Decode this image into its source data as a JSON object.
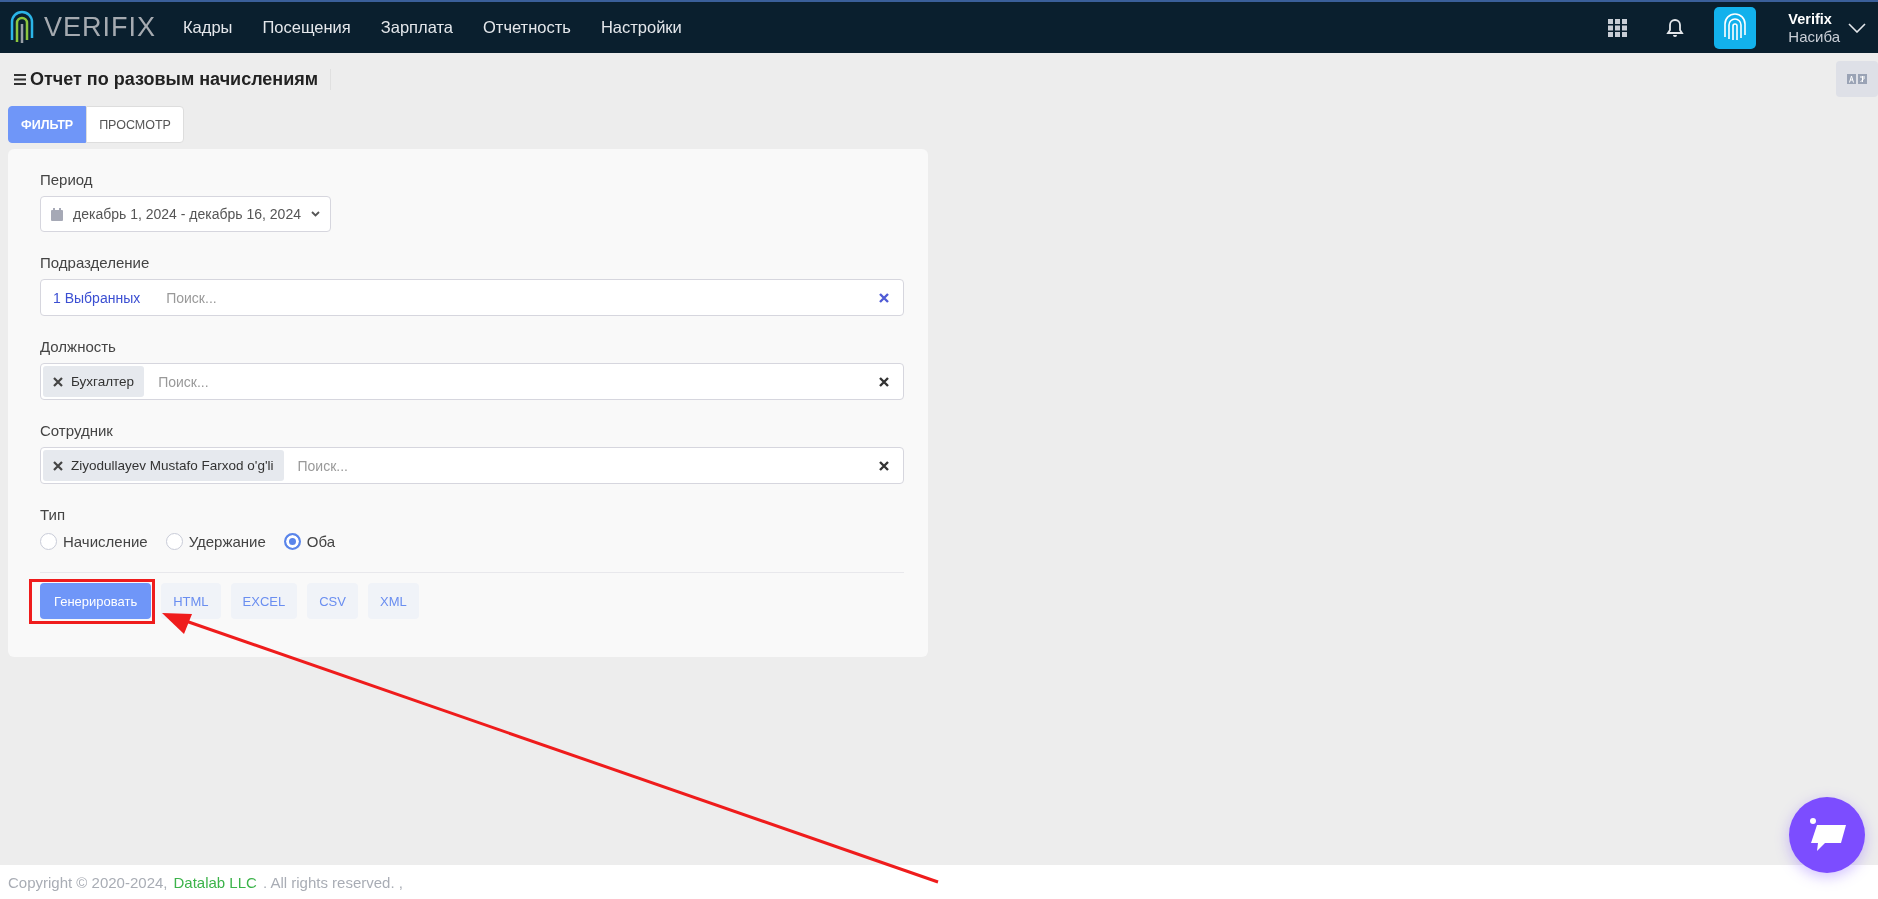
{
  "header": {
    "logo_text": "VERIFIX",
    "nav": [
      "Кадры",
      "Посещения",
      "Зарплата",
      "Отчетность",
      "Настройки"
    ],
    "user": {
      "name": "Verifix",
      "subtitle": "Насиба"
    }
  },
  "page": {
    "title": "Отчет по разовым начислениям"
  },
  "tabs": [
    {
      "label": "ФИЛЬТР",
      "selected": true
    },
    {
      "label": "ПРОСМОТР",
      "selected": false
    }
  ],
  "form": {
    "period": {
      "label": "Период",
      "value": "декабрь 1, 2024 - декабрь 16, 2024"
    },
    "fields": [
      {
        "label": "Подразделение",
        "kind": "summary",
        "summary": "1 Выбранных",
        "placeholder": "Поиск..."
      },
      {
        "label": "Должность",
        "kind": "chips",
        "chips": [
          "Бухгалтер"
        ],
        "placeholder": "Поиск..."
      },
      {
        "label": "Сотрудник",
        "kind": "chips",
        "chips": [
          "Ziyodullayev Mustafo Farxod o'g'li"
        ],
        "placeholder": "Поиск..."
      }
    ],
    "type": {
      "label": "Тип",
      "options": [
        {
          "label": "Начисление",
          "selected": false
        },
        {
          "label": "Удержание",
          "selected": false
        },
        {
          "label": "Оба",
          "selected": true
        }
      ]
    },
    "buttons": [
      {
        "label": "Генерировать",
        "kind": "primary"
      },
      {
        "label": "HTML",
        "kind": "export"
      },
      {
        "label": "EXCEL",
        "kind": "export"
      },
      {
        "label": "CSV",
        "kind": "export"
      },
      {
        "label": "XML",
        "kind": "export"
      }
    ]
  },
  "footer": {
    "prefix": "Copyright © 2020-2024,",
    "link": "Datalab LLC",
    "suffix": ". All rights reserved. ,"
  }
}
